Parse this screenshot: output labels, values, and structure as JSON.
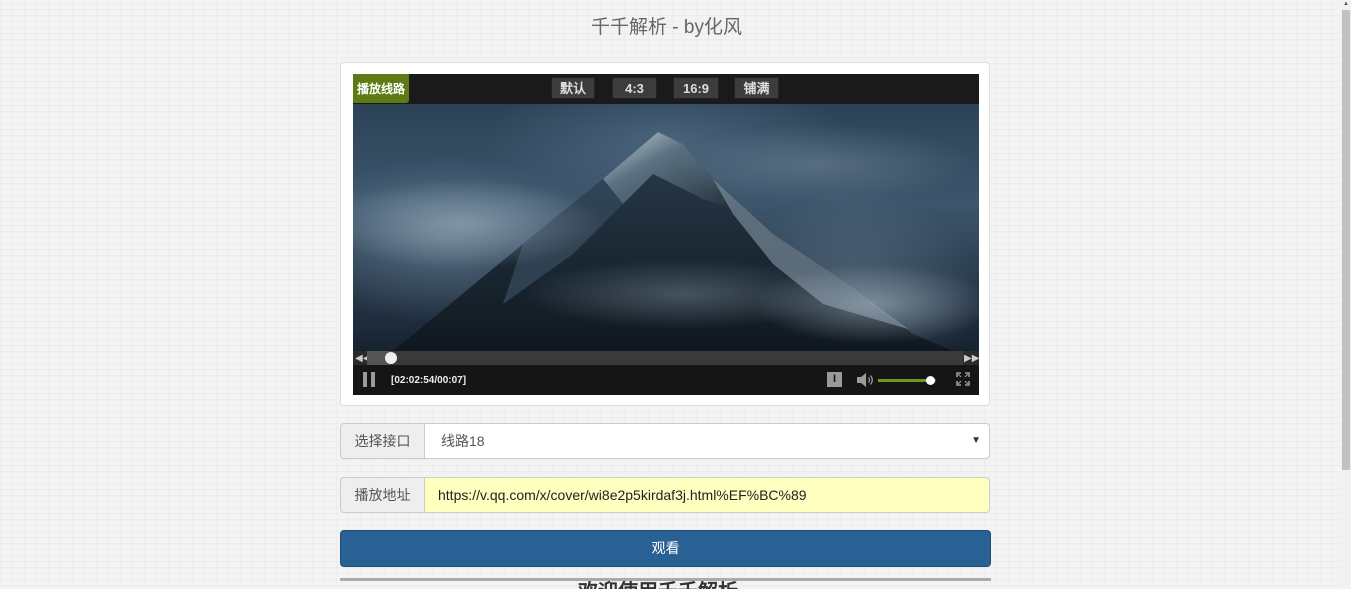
{
  "page": {
    "title": "千千解析 - by化风"
  },
  "player": {
    "line_button": "播放线路",
    "ratio_buttons": [
      "默认",
      "4:3",
      "16:9",
      "铺满"
    ],
    "time": "[02:02:54/00:07]",
    "subtitle_icon": "I",
    "progress_fraction": 0.04,
    "volume_fraction": 0.9,
    "accent_color": "#5d7a14"
  },
  "form": {
    "interface_label": "选择接口",
    "interface_selected": "线路18",
    "url_label": "播放地址",
    "url_value": "https://v.qq.com/x/cover/wi8e2p5kirdaf3j.html%EF%BC%89",
    "watch_button": "观看",
    "button_color": "#2a6195"
  },
  "footer": {
    "partial_text": "欢迎使用千千解析"
  },
  "icons": {
    "pause": "pause-icon",
    "seek_back": "seek-back-icon",
    "seek_forward": "seek-forward-icon",
    "volume": "volume-icon",
    "fullscreen": "fullscreen-icon",
    "dropdown": "chevron-down-icon"
  }
}
